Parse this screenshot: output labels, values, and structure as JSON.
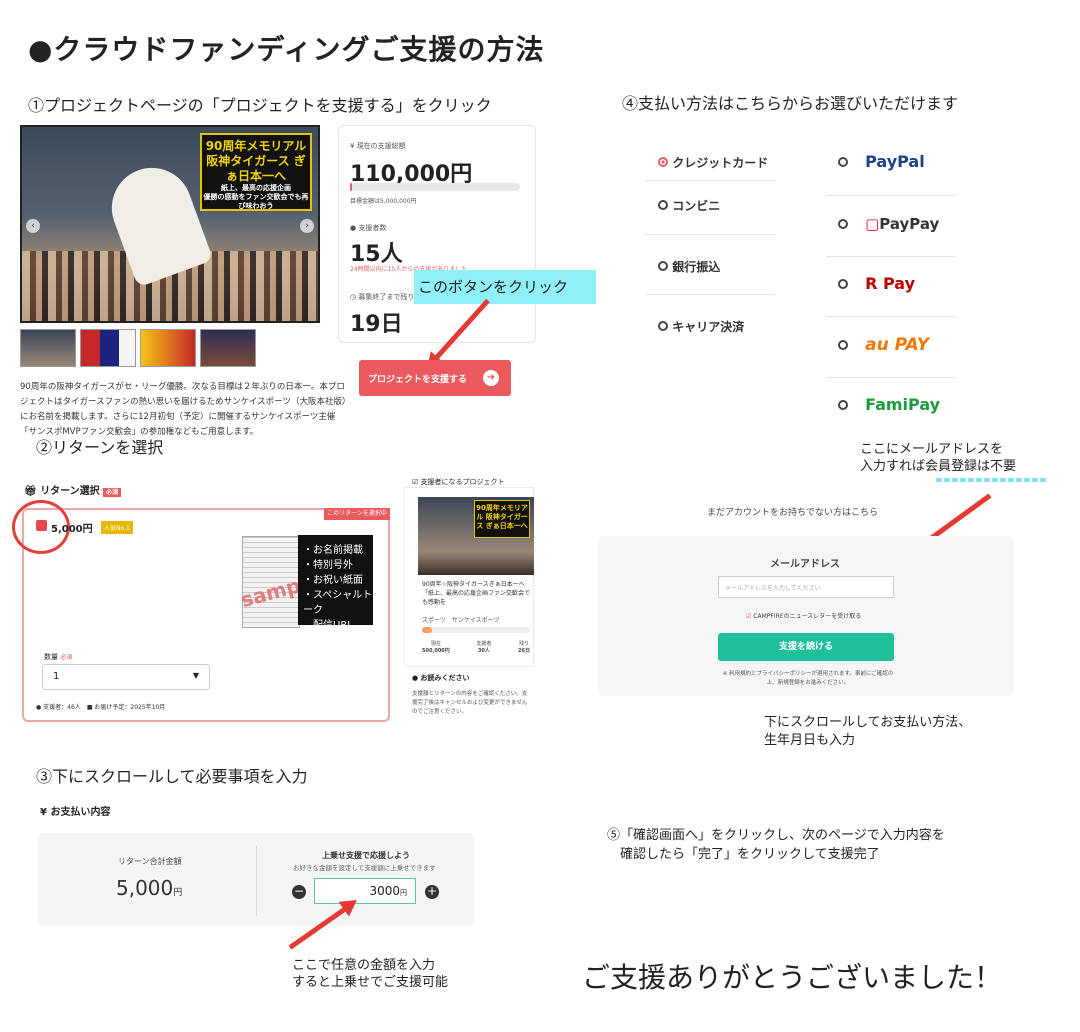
{
  "title": "●クラウドファンディングご支援の方法",
  "step1": {
    "label": "①プロジェクトページの「プロジェクトを支援する」をクリック",
    "banner_main": "90周年メモリアル 阪神タイガース ぎぁ日本一へ",
    "banner_sub": "紙上、最高の応援企画",
    "banner_sub2": "優勝の感動をファン交歓会でも再び味わおう",
    "funding_label": "現在の支援総額",
    "funding_amount": "110,000円",
    "goal_text": "目標金額は5,000,000円",
    "supporters_label": "支援者数",
    "supporters_value": "15人",
    "supporters_note": "24時間以内に15人からの支援がありました",
    "remaining_label": "募集終了まで残り",
    "remaining_value": "19日",
    "callout": "このボタンをクリック",
    "button_label": "プロジェクトを支援する",
    "description": "90周年の阪神タイガースがセ・リーグ優勝。次なる目標は２年ぶりの日本一。本プロジェクトはタイガースファンの熱い思いを届けるためサンケイスポーツ（大阪本社版）にお名前を掲載します。さらに12月初旬（予定）に開催するサンケイスポーツ主催「サンスポMVPファン交歓会」の参加権などもご用意します。"
  },
  "step2": {
    "label": "②リターンを選択",
    "section_title": "リターン選択",
    "section_badge": "必須",
    "selected_tag": "このリターンを選択中",
    "price": "5,000円",
    "popular_badge": "人気No.1",
    "sample": "sample",
    "benefits": [
      "・お名前掲載",
      "・特別号外",
      "・お祝い紙面",
      "・スペシャルトーク",
      "　配信URL"
    ],
    "qty_label": "数量",
    "qty_badge": "必須",
    "qty_value": "1",
    "supporters_info": "支援者：46人",
    "delivery_info": "お届け予定：2025年10月",
    "side_title": "支援者になるプロジェクト",
    "side_text": "90周年☆阪神タイガースぎぁ日本一へ「紙上、最高の応援企画ファン交歓会でも感動を",
    "side_tag1": "スポーツ",
    "side_tag2": "サンケイスポーツ",
    "side_stats": [
      {
        "label": "現在",
        "value": "500,000円"
      },
      {
        "label": "支援者",
        "value": "30人"
      },
      {
        "label": "残り",
        "value": "26日"
      }
    ],
    "notice_title": "お読みください",
    "notice_text": "支援額とリターンの内容をご確認ください。支援完了後はキャンセルおよび変更ができませんのでご注意ください。"
  },
  "step3": {
    "label": "③下にスクロールして必要事項を入力",
    "section_title": "¥ お支払い内容",
    "total_label": "リターン合計金額",
    "total_value": "5,000",
    "total_unit": "円",
    "extra_title": "上乗せ支援で応援しよう",
    "extra_sub": "お好きな金額を設定して支援額に上乗せできます",
    "extra_value": "3000",
    "extra_unit": "円",
    "note": "ここで任意の金額を入力\nすると上乗せでご支援可能"
  },
  "step4": {
    "label": "④支払い方法はこちらからお選びいただけます",
    "methods_left": [
      "クレジットカード",
      "コンビニ",
      "銀行振込",
      "キャリア決済"
    ],
    "methods_right": [
      "PayPal",
      "PayPay",
      "R Pay",
      "au PAY",
      "FamiPay"
    ],
    "note_top": "ここにメールアドレスを\n入力すれば会員登録は不要",
    "no_account": "まだアカウントをお持ちでない方はこちら",
    "email_label": "メールアドレス",
    "email_placeholder": "メールアドレスを入力してください",
    "newsletter": "CAMPFIREのニュースレターを受け取る",
    "continue_button": "支援を続ける",
    "terms": "※ 利用規約とプライバシーポリシーが適用されます。事前にご確認の上、新規登録をお進みください。",
    "note_bottom": "下にスクロールしてお支払い方法、\n生年月日も入力"
  },
  "step5": {
    "label": "⑤「確認画面へ」をクリックし、次のページで入力内容を\n　確認したら「完了」をクリックして支援完了"
  },
  "thanks": "ご支援ありがとうございました！",
  "colors": {
    "accent_red": "#ea5a5f",
    "teal": "#1fbf9b",
    "callout_cyan": "#8ff0f7",
    "paypal_blue": "#1f3f8f",
    "paypay_red": "#e6003a",
    "rakuten_red": "#bf0000",
    "au_orange": "#f07800",
    "famipay_green": "#1e9c3c"
  },
  "icons": [
    "yen-icon",
    "person-icon",
    "clock-icon",
    "arrow-right-icon",
    "checkbox-icon",
    "chevron-down-icon",
    "minus-icon",
    "plus-icon",
    "radio-icon"
  ]
}
